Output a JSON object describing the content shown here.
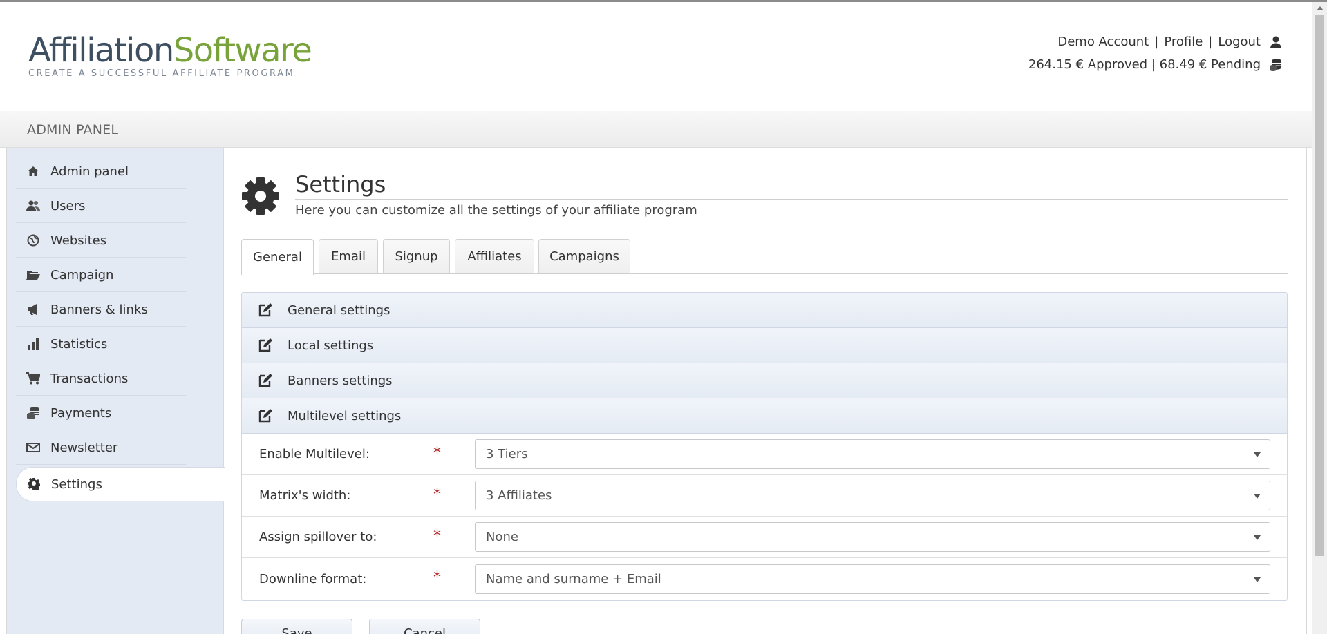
{
  "header": {
    "logo": {
      "part1": "Affiliation",
      "part2": "Software",
      "tagline": "CREATE A SUCCESSFUL AFFILIATE PROGRAM"
    },
    "user_links": {
      "account": "Demo Account",
      "separator": "|",
      "profile": "Profile",
      "logout": "Logout"
    },
    "balance": "264.15 € Approved | 68.49 € Pending"
  },
  "panelbar": {
    "title": "ADMIN PANEL"
  },
  "sidebar": {
    "items": [
      {
        "label": "Admin panel",
        "icon": "home-icon"
      },
      {
        "label": "Users",
        "icon": "users-icon"
      },
      {
        "label": "Websites",
        "icon": "globe-icon"
      },
      {
        "label": "Campaign",
        "icon": "folder-icon"
      },
      {
        "label": "Banners & links",
        "icon": "megaphone-icon"
      },
      {
        "label": "Statistics",
        "icon": "bar-chart-icon"
      },
      {
        "label": "Transactions",
        "icon": "cart-icon"
      },
      {
        "label": "Payments",
        "icon": "coins-icon"
      },
      {
        "label": "Newsletter",
        "icon": "envelope-icon"
      },
      {
        "label": "Settings",
        "icon": "gear-icon",
        "active": true
      }
    ]
  },
  "page": {
    "title": "Settings",
    "subtitle": "Here you can customize all the settings of your affiliate program"
  },
  "tabs": [
    {
      "label": "General",
      "active": true
    },
    {
      "label": "Email"
    },
    {
      "label": "Signup"
    },
    {
      "label": "Affiliates"
    },
    {
      "label": "Campaigns"
    }
  ],
  "sections": [
    {
      "label": "General settings"
    },
    {
      "label": "Local settings"
    },
    {
      "label": "Banners settings"
    },
    {
      "label": "Multilevel settings",
      "expanded": true
    }
  ],
  "fields": [
    {
      "label": "Enable Multilevel:",
      "required": "*",
      "value": "3 Tiers"
    },
    {
      "label": "Matrix's width:",
      "required": "*",
      "value": "3 Affiliates"
    },
    {
      "label": "Assign spillover to:",
      "required": "*",
      "value": "None"
    },
    {
      "label": "Downline format:",
      "required": "*",
      "value": "Name and surname + Email"
    }
  ],
  "buttons": {
    "save": "Save",
    "cancel": "Cancel"
  },
  "colors": {
    "logo_dark": "#3f4f62",
    "logo_green": "#78a33a",
    "sidebar_bg": "#e4eaf3",
    "required": "#aa2222"
  }
}
